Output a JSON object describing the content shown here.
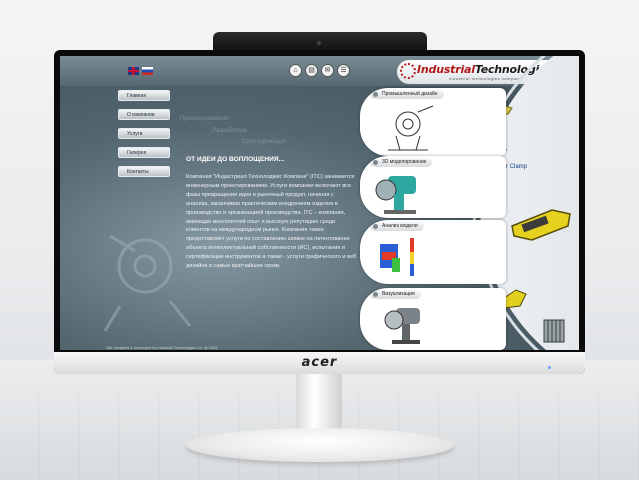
{
  "monitor": {
    "brand": "acer"
  },
  "header": {
    "logo_part1": "Industrial",
    "logo_part2": "TechnologiesCo",
    "logo_tagline": "industrial technologies company",
    "top_icons": [
      "home-icon",
      "print-icon",
      "mail-icon",
      "sitemap-icon"
    ]
  },
  "nav": {
    "items": [
      {
        "label": "Главная"
      },
      {
        "label": "О компании"
      },
      {
        "label": "Услуги"
      },
      {
        "label": "Галерея"
      },
      {
        "label": "Контакты"
      }
    ]
  },
  "ghost_words": [
    "Проектирование",
    "Разработка",
    "Сертификация"
  ],
  "content": {
    "heading": "ОТ ИДЕИ ДО ВОПЛОЩЕНИЯ...",
    "body": "Компания \"Индастриал Технолоджис Компани\" (ITC) занимается инженерным проектированием. Услуги компании включают все фазы превращения идеи в рыночный продукт, начиная с анализа, заканчивая практическим внедрением изделия в производство и организацией производства. ITC – компания, имеющая многолетний опыт и высокую репутацию среди клиентов на международном рынке. Компания также предоставляет услуги по составлению заявок на патентование объекта интеллектуальной собственности (ИС), испытания и сертификации инструментов а также - услуги графического и веб дизайна в самые кратчайшие сроки."
  },
  "footer": "Site designed & developed by Industrial Technologies Co. @ 2009",
  "services": [
    {
      "label": "Промышленный дизайн"
    },
    {
      "label": "3D моделирование"
    },
    {
      "label": "Анализ модели"
    },
    {
      "label": "Визуализация"
    }
  ],
  "gallery": {
    "title": "Power Bar Clamp"
  },
  "colors": {
    "screen_bg": "#54666f",
    "logo_red": "#b01818",
    "nav_button": "#d6dde1",
    "panel_title": "#123a8c"
  }
}
